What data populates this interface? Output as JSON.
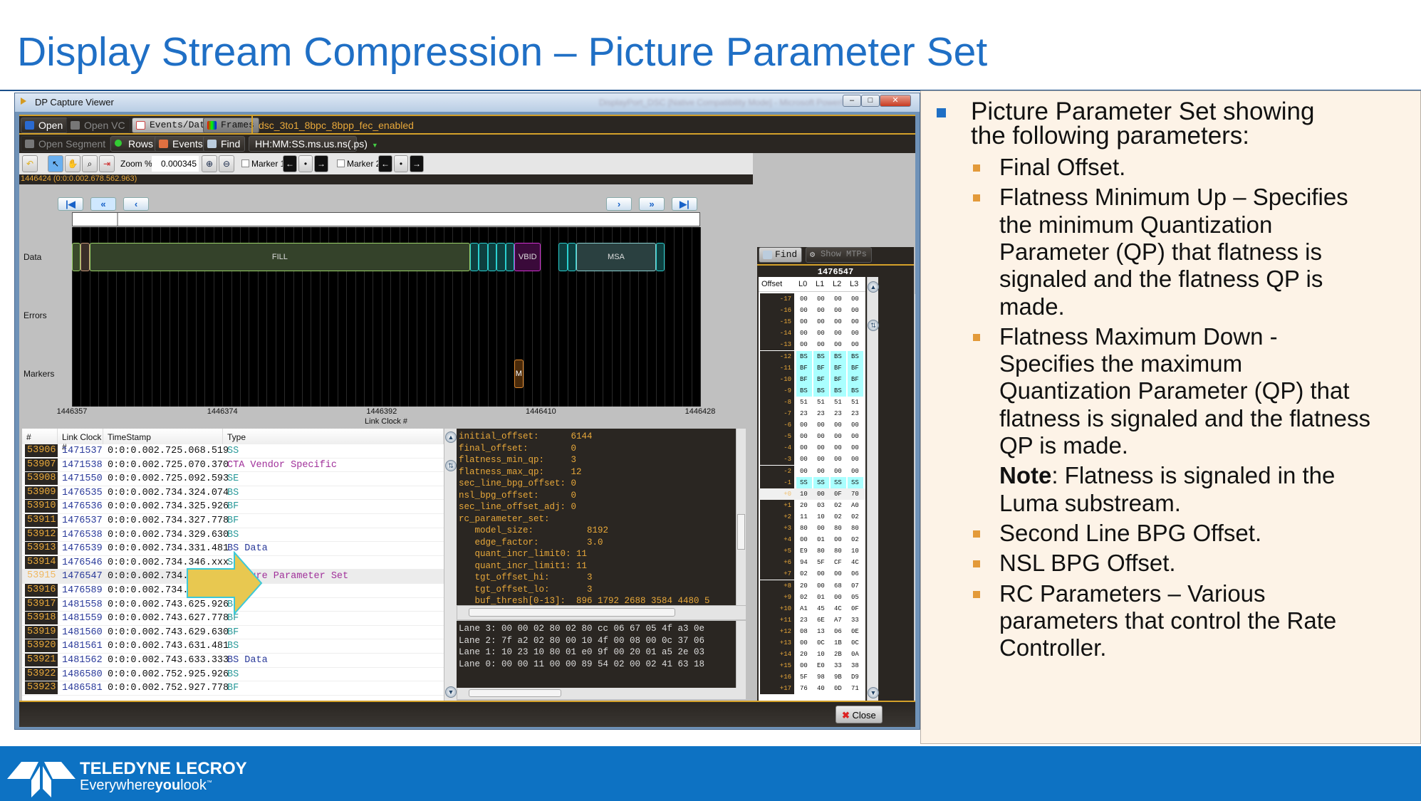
{
  "slide": {
    "title": "Display Stream Compression – Picture Parameter Set"
  },
  "window": {
    "title": "DP Capture Viewer",
    "blurred_title": "DisplayPort_DSC [Native Compatibility Mode] - Microsoft PowerPoint",
    "toolbar1": {
      "open": "Open",
      "open_vc": "Open VC",
      "events_data": "Events/Data",
      "frames": "Frames",
      "filename": "dsc_3to1_8bpc_8bpp_fec_enabled"
    },
    "toolbar2": {
      "open_segment": "Open Segment",
      "rows": "Rows",
      "events": "Events",
      "find": "Find",
      "time_format": "HH:MM:SS.ms.us.ns(.ps)"
    },
    "toolbar3": {
      "zoom_label": "Zoom %:",
      "zoom_value": "0.000345",
      "marker1": "Marker 1",
      "marker2": "Marker 2"
    },
    "status": "1446424 (0:0:0.002.678.562.963)",
    "close": "Close"
  },
  "waveform": {
    "row_labels": [
      "Data",
      "Errors",
      "Markers"
    ],
    "x_label": "Link Clock #",
    "x_range": [
      1446357,
      1446428
    ],
    "ticks": [
      "1446357",
      "1446374",
      "1446392",
      "1446410",
      "1446428"
    ],
    "segments": [
      {
        "label": "",
        "start": 1446357,
        "end": 1446358,
        "color": "#3a4a2a",
        "border": "#9cd46a"
      },
      {
        "label": "",
        "start": 1446358,
        "end": 1446359,
        "color": "#3a2e28",
        "border": "#c89a7a"
      },
      {
        "label": "FILL",
        "start": 1446359,
        "end": 1446402,
        "color": "#34422a",
        "border": "#9cd46a"
      },
      {
        "label": "",
        "start": 1446402,
        "end": 1446403,
        "color": "#0e3f3f",
        "border": "#2ad0d0"
      },
      {
        "label": "",
        "start": 1446403,
        "end": 1446404,
        "color": "#0e3f3f",
        "border": "#2ad0d0"
      },
      {
        "label": "",
        "start": 1446404,
        "end": 1446405,
        "color": "#0e3f3f",
        "border": "#2ad0d0"
      },
      {
        "label": "",
        "start": 1446405,
        "end": 1446406,
        "color": "#0e3f3f",
        "border": "#2ad0d0"
      },
      {
        "label": "",
        "start": 1446406,
        "end": 1446407,
        "color": "#0e3f3f",
        "border": "#2ad0d0"
      },
      {
        "label": "VBID",
        "start": 1446407,
        "end": 1446410,
        "color": "#3a0a3a",
        "border": "#d030d0"
      },
      {
        "label": "",
        "start": 1446412,
        "end": 1446413,
        "color": "#0e3f3f",
        "border": "#2ad0d0"
      },
      {
        "label": "",
        "start": 1446413,
        "end": 1446414,
        "color": "#0e3f3f",
        "border": "#2ad0d0"
      },
      {
        "label": "MSA",
        "start": 1446414,
        "end": 1446423,
        "color": "#2a4040",
        "border": "#8ad0d0"
      },
      {
        "label": "",
        "start": 1446423,
        "end": 1446424,
        "color": "#0e3f3f",
        "border": "#2ad0d0"
      }
    ],
    "markers": [
      {
        "label": "M",
        "start": 1446407,
        "end": 1446408
      }
    ]
  },
  "table": {
    "headers": [
      "#",
      "Link Clock #",
      "TimeStamp",
      "Type"
    ],
    "selected_index": 9,
    "rows": [
      [
        "53906",
        "1471537",
        "0:0:0.002.725.068.519",
        "SS",
        "#2a9a9a"
      ],
      [
        "53907",
        "1471538",
        "0:0:0.002.725.070.370",
        "CTA Vendor Specific",
        "#a0309a"
      ],
      [
        "53908",
        "1471550",
        "0:0:0.002.725.092.593",
        "SE",
        "#2a9a9a"
      ],
      [
        "53909",
        "1476535",
        "0:0:0.002.734.324.074",
        "BS",
        "#2a9a9a"
      ],
      [
        "53910",
        "1476536",
        "0:0:0.002.734.325.926",
        "BF",
        "#2a9a9a"
      ],
      [
        "53911",
        "1476537",
        "0:0:0.002.734.327.778",
        "BF",
        "#2a9a9a"
      ],
      [
        "53912",
        "1476538",
        "0:0:0.002.734.329.630",
        "BS",
        "#2a9a9a"
      ],
      [
        "53913",
        "1476539",
        "0:0:0.002.734.331.481",
        "BS Data",
        "#2a3a9a"
      ],
      [
        "53914",
        "1476546",
        "0:0:0.002.734.346.xxx",
        "SS",
        "#2a9a9a"
      ],
      [
        "53915",
        "1476547",
        "0:0:0.002.734.xxx.xxx",
        "Picture Parameter Set",
        "#a0309a"
      ],
      [
        "53916",
        "1476589",
        "0:0:0.002.734.424.074",
        "SE",
        "#2a9a9a"
      ],
      [
        "53917",
        "1481558",
        "0:0:0.002.743.625.926",
        "BS",
        "#2a9a9a"
      ],
      [
        "53918",
        "1481559",
        "0:0:0.002.743.627.778",
        "BF",
        "#2a9a9a"
      ],
      [
        "53919",
        "1481560",
        "0:0:0.002.743.629.630",
        "BF",
        "#2a9a9a"
      ],
      [
        "53920",
        "1481561",
        "0:0:0.002.743.631.481",
        "BS",
        "#2a9a9a"
      ],
      [
        "53921",
        "1481562",
        "0:0:0.002.743.633.333",
        "BS Data",
        "#2a3a9a"
      ],
      [
        "53922",
        "1486580",
        "0:0:0.002.752.925.926",
        "BS",
        "#2a9a9a"
      ],
      [
        "53923",
        "1486581",
        "0:0:0.002.752.927.778",
        "BF",
        "#2a9a9a"
      ]
    ]
  },
  "params": [
    "initial_offset:      6144",
    "final_offset:        0",
    "flatness_min_qp:     3",
    "flatness_max_qp:     12",
    "sec_line_bpg_offset: 0",
    "nsl_bpg_offset:      0",
    "sec_line_offset_adj: 0",
    "rc_parameter_set:",
    "   model_size:          8192",
    "   edge_factor:         3.0",
    "   quant_incr_limit0: 11",
    "   quant_incr_limit1: 11",
    "   tgt_offset_hi:       3",
    "   tgt_offset_lo:       3",
    "   buf_thresh[0-13]:  896 1792 2688 3584 4480 5"
  ],
  "hex_lanes": [
    "Lane 3: 00 00 02 80 02 80 cc 06 67 05 4f a3 0e",
    "Lane 2: 7f a2 02 80 00 10 4f 00 08 00 0c 37 06",
    "Lane 1: 10 23 10 80 01 e0 9f 00 20 01 a5 2e 03",
    "Lane 0: 00 00 11 00 00 89 54 02 00 02 41 63 18"
  ],
  "lane_panel": {
    "find": "Find",
    "show_mtps": "Show MTPs",
    "clock": "1476547",
    "headers": [
      "Offset",
      "L0",
      "L1",
      "L2",
      "L3"
    ],
    "rows": [
      [
        "-17",
        "00",
        "00",
        "00",
        "00"
      ],
      [
        "-16",
        "00",
        "00",
        "00",
        "00"
      ],
      [
        "-15",
        "00",
        "00",
        "00",
        "00"
      ],
      [
        "-14",
        "00",
        "00",
        "00",
        "00"
      ],
      [
        "-13",
        "00",
        "00",
        "00",
        "00"
      ],
      [
        "-12",
        "BS",
        "BS",
        "BS",
        "BS"
      ],
      [
        "-11",
        "BF",
        "BF",
        "BF",
        "BF"
      ],
      [
        "-10",
        "BF",
        "BF",
        "BF",
        "BF"
      ],
      [
        "-9",
        "BS",
        "BS",
        "BS",
        "BS"
      ],
      [
        "-8",
        "51",
        "51",
        "51",
        "51"
      ],
      [
        "-7",
        "23",
        "23",
        "23",
        "23"
      ],
      [
        "-6",
        "00",
        "00",
        "00",
        "00"
      ],
      [
        "-5",
        "00",
        "00",
        "00",
        "00"
      ],
      [
        "-4",
        "00",
        "00",
        "00",
        "00"
      ],
      [
        "-3",
        "00",
        "00",
        "00",
        "00"
      ],
      [
        "-2",
        "00",
        "00",
        "00",
        "00"
      ],
      [
        "-1",
        "SS",
        "SS",
        "SS",
        "SS"
      ],
      [
        "+0",
        "10",
        "00",
        "0F",
        "70"
      ],
      [
        "+1",
        "20",
        "03",
        "02",
        "A0"
      ],
      [
        "+2",
        "11",
        "10",
        "02",
        "02"
      ],
      [
        "+3",
        "80",
        "00",
        "80",
        "80"
      ],
      [
        "+4",
        "00",
        "01",
        "00",
        "02"
      ],
      [
        "+5",
        "E9",
        "80",
        "80",
        "10"
      ],
      [
        "+6",
        "94",
        "5F",
        "CF",
        "4C"
      ],
      [
        "+7",
        "02",
        "00",
        "00",
        "06"
      ],
      [
        "+8",
        "20",
        "00",
        "68",
        "07"
      ],
      [
        "+9",
        "02",
        "01",
        "00",
        "05"
      ],
      [
        "+10",
        "A1",
        "45",
        "4C",
        "0F"
      ],
      [
        "+11",
        "23",
        "6E",
        "A7",
        "33"
      ],
      [
        "+12",
        "08",
        "13",
        "06",
        "0E"
      ],
      [
        "+13",
        "00",
        "0C",
        "1B",
        "0C"
      ],
      [
        "+14",
        "20",
        "10",
        "2B",
        "0A"
      ],
      [
        "+15",
        "00",
        "E0",
        "33",
        "38"
      ],
      [
        "+16",
        "5F",
        "98",
        "9B",
        "D9"
      ],
      [
        "+17",
        "76",
        "40",
        "0D",
        "71"
      ]
    ],
    "highlight_rows": [
      "-12",
      "-11",
      "-10",
      "-9",
      "-1"
    ],
    "selected_row": "+0"
  },
  "bullets": [
    {
      "level": 1,
      "lines": [
        "Picture Parameter Set showing",
        "the following parameters:"
      ]
    },
    {
      "level": 2,
      "lines": [
        "Final Offset."
      ]
    },
    {
      "level": 2,
      "lines": [
        "Flatness Minimum Up – Specifies",
        "the minimum Quantization",
        "Parameter (QP) that flatness is",
        "signaled and the flatness QP is",
        "made."
      ]
    },
    {
      "level": 2,
      "lines": [
        "Flatness Maximum Down -",
        "Specifies the maximum",
        "Quantization Parameter (QP) that",
        "flatness is signaled and the flatness",
        "QP is made."
      ]
    },
    {
      "level": 0,
      "note_label": "Note",
      "lines": [
        ": Flatness is signaled in the",
        "Luma substream."
      ]
    },
    {
      "level": 2,
      "lines": [
        "Second Line BPG Offset."
      ]
    },
    {
      "level": 2,
      "lines": [
        "NSL BPG Offset."
      ]
    },
    {
      "level": 2,
      "lines": [
        "RC Parameters – Various",
        "parameters that control the Rate",
        "Controller."
      ]
    }
  ],
  "footer": {
    "brand": "TELEDYNE LECROY",
    "tagline_a": "Everywhere",
    "tagline_b": "you",
    "tagline_c": "look",
    "tm": "™"
  },
  "colors": {
    "title_blue": "#1f6fc5",
    "footer_blue": "#0d72c3",
    "accent_orange": "#e8a83a",
    "bullet_orange": "#e39a3a"
  }
}
